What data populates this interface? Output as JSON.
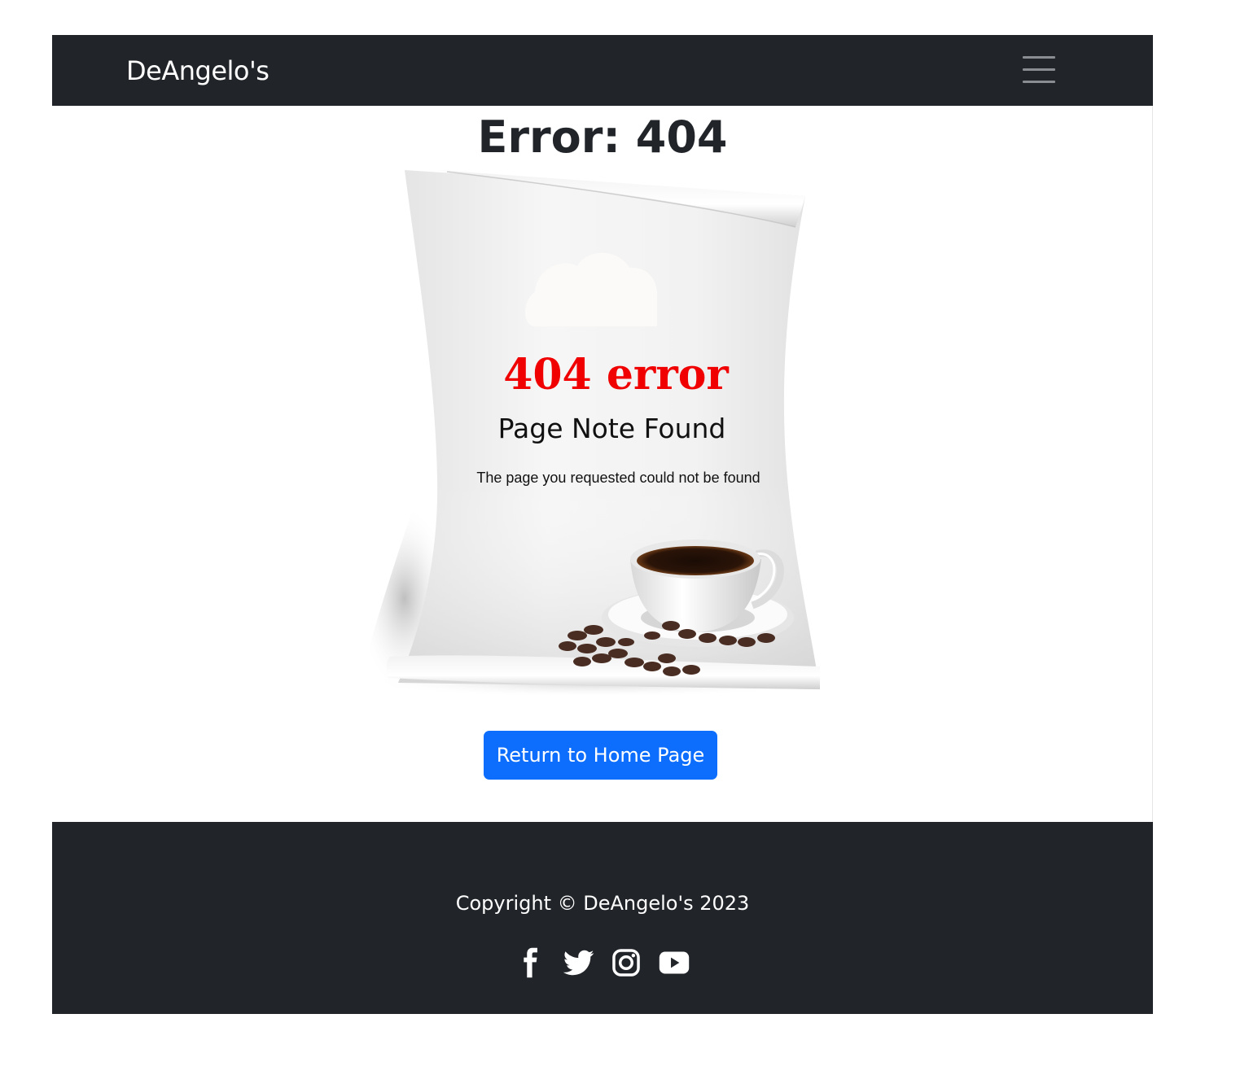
{
  "navbar": {
    "brand": "DeAngelo's",
    "toggle_icon": "hamburger-menu-icon"
  },
  "main": {
    "title": "Error: 404",
    "illustration": {
      "headline": "404 error",
      "subheadline": "Page Note Found",
      "message": "The page you requested could not be found",
      "icons": [
        "cloud-icon",
        "coffee-cup-icon",
        "coffee-beans-icon"
      ]
    },
    "home_button": "Return to Home Page"
  },
  "footer": {
    "copyright": "Copyright © DeAngelo's 2023",
    "socials": [
      {
        "icon": "facebook-icon"
      },
      {
        "icon": "twitter-icon"
      },
      {
        "icon": "instagram-icon"
      },
      {
        "icon": "youtube-icon"
      }
    ]
  },
  "colors": {
    "dark": "#212529",
    "primary": "#0d6efd",
    "error_red": "#f00000",
    "toggler": "#8a8d91"
  }
}
